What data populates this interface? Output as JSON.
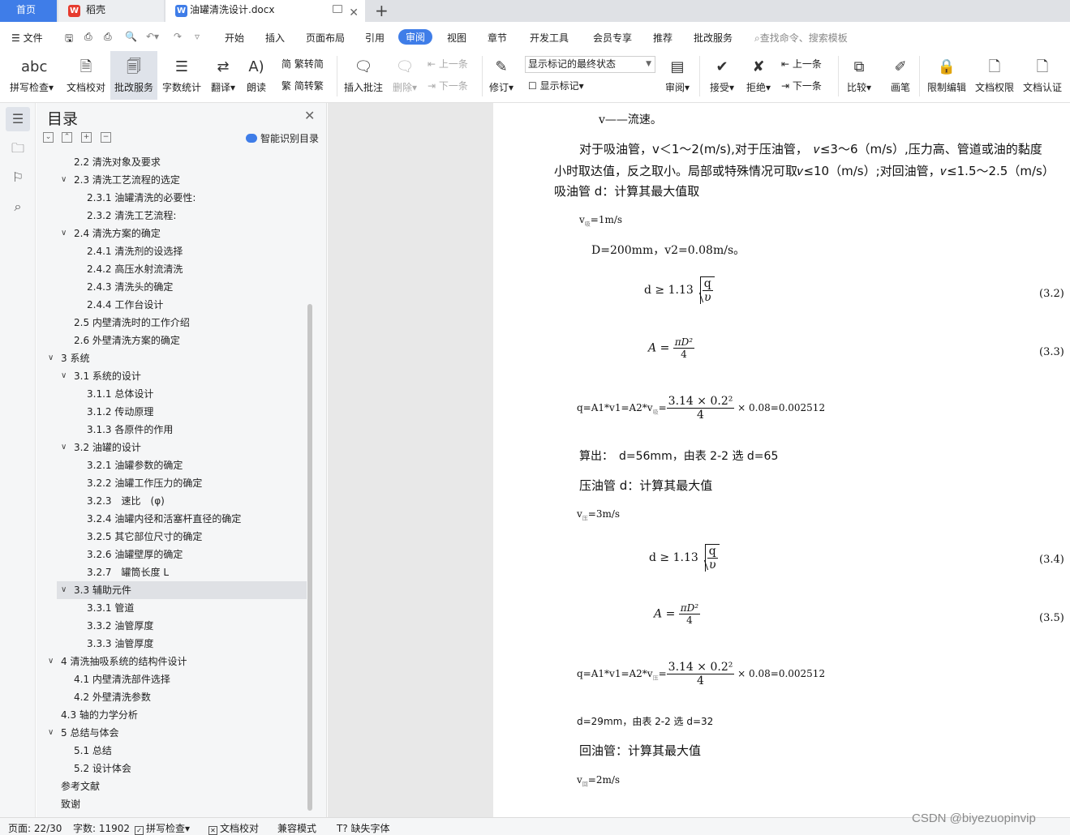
{
  "tabs": {
    "home": "首页",
    "docer": "稻壳",
    "doc": "油罐清洗设计.docx"
  },
  "menu": {
    "file": "文件",
    "items": [
      "开始",
      "插入",
      "页面布局",
      "引用",
      "审阅",
      "视图",
      "章节",
      "开发工具",
      "会员专享",
      "推荐",
      "批改服务"
    ],
    "active": "审阅",
    "search": "查找命令、搜索模板"
  },
  "ribbon": {
    "spellcheck": "拼写检查",
    "doccheck": "文档校对",
    "correction": "批改服务",
    "wordcount": "字数统计",
    "translate": "翻译",
    "read": "朗读",
    "to_traditional": "繁转简",
    "to_simplified": "简转繁",
    "insert_comment": "插入批注",
    "delete": "删除",
    "prev": "上一条",
    "next": "下一条",
    "revise": "修订",
    "markup_state": "显示标记的最终状态",
    "show_markup": "显示标记",
    "review": "审阅",
    "accept": "接受",
    "reject": "拒绝",
    "prev2": "上一条",
    "next2": "下一条",
    "compare": "比较",
    "pen": "画笔",
    "restrict": "限制编辑",
    "permission": "文档权限",
    "certify": "文档认证"
  },
  "toc": {
    "title": "目录",
    "smart": "智能识别目录",
    "items": [
      {
        "label": "2.2 清洗对象及要求",
        "level": 2,
        "chev": false
      },
      {
        "label": "2.3 清洗工艺流程的选定",
        "level": 2,
        "chev": true
      },
      {
        "label": "2.3.1 油罐清洗的必要性:",
        "level": 3,
        "chev": false
      },
      {
        "label": "2.3.2 清洗工艺流程:",
        "level": 3,
        "chev": false
      },
      {
        "label": "2.4 清洗方案的确定",
        "level": 2,
        "chev": true
      },
      {
        "label": "2.4.1 清洗剂的设选择",
        "level": 3,
        "chev": false
      },
      {
        "label": "2.4.2 高压水射流清洗",
        "level": 3,
        "chev": false
      },
      {
        "label": "2.4.3 清洗头的确定",
        "level": 3,
        "chev": false
      },
      {
        "label": "2.4.4 工作台设计",
        "level": 3,
        "chev": false
      },
      {
        "label": "2.5 内壁清洗时的工作介绍",
        "level": 2,
        "chev": false
      },
      {
        "label": "2.6 外壁清洗方案的确定",
        "level": 2,
        "chev": false
      },
      {
        "label": "3 系统",
        "level": 1,
        "chev": true
      },
      {
        "label": "3.1 系统的设计",
        "level": 2,
        "chev": true
      },
      {
        "label": "3.1.1 总体设计",
        "level": 3,
        "chev": false
      },
      {
        "label": "3.1.2 传动原理",
        "level": 3,
        "chev": false
      },
      {
        "label": "3.1.3 各原件的作用",
        "level": 3,
        "chev": false
      },
      {
        "label": "3.2 油罐的设计",
        "level": 2,
        "chev": true
      },
      {
        "label": "3.2.1 油罐参数的确定",
        "level": 3,
        "chev": false
      },
      {
        "label": "3.2.2 油罐工作压力的确定",
        "level": 3,
        "chev": false
      },
      {
        "label": "3.2.3　速比　(φ)",
        "level": 3,
        "chev": false
      },
      {
        "label": "3.2.4 油罐内径和活塞杆直径的确定",
        "level": 3,
        "chev": false
      },
      {
        "label": "3.2.5 其它部位尺寸的确定",
        "level": 3,
        "chev": false
      },
      {
        "label": "3.2.6 油罐壁厚的确定",
        "level": 3,
        "chev": false
      },
      {
        "label": "3.2.7　罐筒长度 L",
        "level": 3,
        "chev": false
      },
      {
        "label": "3.3 辅助元件",
        "level": 2,
        "chev": true,
        "selected": true
      },
      {
        "label": "3.3.1 管道",
        "level": 3,
        "chev": false
      },
      {
        "label": "3.3.2 油管厚度",
        "level": 3,
        "chev": false
      },
      {
        "label": "3.3.3 油管厚度",
        "level": 3,
        "chev": false
      },
      {
        "label": "4 清洗抽吸系统的结构件设计",
        "level": 1,
        "chev": true
      },
      {
        "label": "4.1 内壁清洗部件选择",
        "level": 2,
        "chev": false
      },
      {
        "label": "4.2 外壁清洗参数",
        "level": 2,
        "chev": false
      },
      {
        "label": "4.3 轴的力学分析",
        "level": 1,
        "chev": false
      },
      {
        "label": "5 总结与体会",
        "level": 1,
        "chev": true
      },
      {
        "label": "5.1 总结",
        "level": 2,
        "chev": false
      },
      {
        "label": "5.2 设计体会",
        "level": 2,
        "chev": false
      },
      {
        "label": "参考文献",
        "level": 1,
        "chev": false
      },
      {
        "label": "致谢",
        "level": 1,
        "chev": false
      }
    ]
  },
  "doc": {
    "l1": "v——流速。",
    "l2": "对于吸油管，v＜1～2(m/s),对于压油管，　𝜈≤3～6（m/s）,压力高、管道或油的黏度",
    "l3": "小时取达值，反之取小。局部或特殊情况可取𝜈≤10（m/s）;对回油管，𝜈≤1.5～2.5（m/s）",
    "l4": "吸油管 d：计算其最大值取",
    "l5a": "v",
    "l5sub": "吸",
    "l5b": "=1m/s",
    "l6": "D=200mm，v2=0.08m/s。",
    "eq1_prefix": "d ≥ 1.13",
    "eq1_num": "q",
    "eq1_den": "υ",
    "eq1_no": "(3.2)",
    "eq2_A": "A",
    "eq2_eq": "=",
    "eq2_num": "πD²",
    "eq2_den": "4",
    "eq2_no": "(3.3)",
    "eq3_prefix": "q=A1*v1=A2*v",
    "eq3_sub": "吸",
    "eq3_eq": "=",
    "eq3_num": "3.14 × 0.2²",
    "eq3_den": "4",
    "eq3_suffix": "× 0.08=0.002512",
    "l7": "算出：　d=56mm，由表 2-2 选 d=65",
    "l8": "压油管 d：计算其最大值",
    "l9a": "v",
    "l9sub": "压",
    "l9b": "=3m/s",
    "eq4_prefix": "d ≥ 1.13",
    "eq4_num": "q",
    "eq4_den": "υ",
    "eq4_no": "(3.4)",
    "eq5_A": "A",
    "eq5_eq": "=",
    "eq5_num": "πD²",
    "eq5_den": "4",
    "eq5_no": "(3.5)",
    "eq6_prefix": "q=A1*v1=A2*v",
    "eq6_sub": "压",
    "eq6_eq": "=",
    "eq6_num": "3.14 × 0.2²",
    "eq6_den": "4",
    "eq6_suffix": "× 0.08=0.002512",
    "l10": "d=29mm，由表 2-2 选 d=32",
    "l11": "回油管：计算其最大值",
    "l12a": "v",
    "l12sub": "回",
    "l12b": "=2m/s"
  },
  "status": {
    "page": "页面: 22/30",
    "words": "字数: 11902",
    "spell": "拼写检查",
    "doccheck": "文档校对",
    "compat": "兼容模式",
    "missing_font": "缺失字体"
  },
  "watermark": "CSDN @biyezuopinvip"
}
